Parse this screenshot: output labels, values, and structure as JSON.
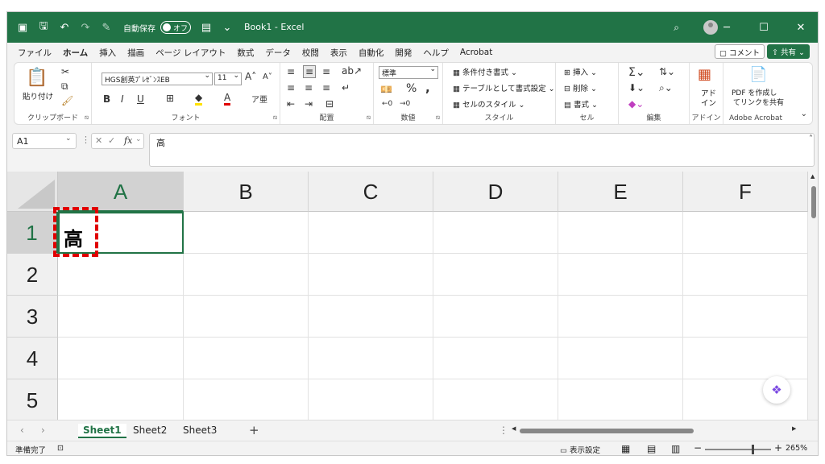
{
  "titlebar": {
    "autosave_label": "自動保存",
    "toggle_label": "オフ",
    "doc_title": "Book1  -  Excel",
    "bg_color": "#217346"
  },
  "menu": {
    "tabs": [
      "ファイル",
      "ホーム",
      "挿入",
      "描画",
      "ページ レイアウト",
      "数式",
      "データ",
      "校閲",
      "表示",
      "自動化",
      "開発",
      "ヘルプ",
      "Acrobat"
    ],
    "active": "ホーム",
    "comment_label": "コメント",
    "share_label": "共有"
  },
  "ribbon": {
    "clipboard": {
      "label": "クリップボード",
      "paste_label": "貼り付け"
    },
    "font": {
      "label": "フォント",
      "font_name": "HGS創英ﾌﾟﾚｾﾞﾝｽEB",
      "font_size": "11"
    },
    "alignment": {
      "label": "配置"
    },
    "number": {
      "label": "数値",
      "format": "標準"
    },
    "styles": {
      "label": "スタイル",
      "conditional": "条件付き書式",
      "table": "テーブルとして書式設定",
      "cell_styles": "セルのスタイル"
    },
    "cells": {
      "label": "セル",
      "insert": "挿入",
      "delete": "削除",
      "format": "書式"
    },
    "editing": {
      "label": "編集"
    },
    "addins": {
      "label": "アドイン",
      "button_line1": "アド",
      "button_line2": "イン"
    },
    "acrobat": {
      "label": "Adobe Acrobat",
      "button_line1": "PDF を作成し",
      "button_line2": "てリンクを共有"
    }
  },
  "formula_bar": {
    "name_box": "A1",
    "fx": "fx",
    "content": "高"
  },
  "grid": {
    "columns": [
      "A",
      "B",
      "C",
      "D",
      "E",
      "F"
    ],
    "rows": [
      "1",
      "2",
      "3",
      "4",
      "5"
    ],
    "active_cell": "A1",
    "cell_a1": "高"
  },
  "sheets": {
    "tabs": [
      "Sheet1",
      "Sheet2",
      "Sheet3"
    ],
    "active": "Sheet1"
  },
  "status": {
    "ready": "準備完了",
    "display_settings": "表示設定",
    "zoom": "265%"
  }
}
